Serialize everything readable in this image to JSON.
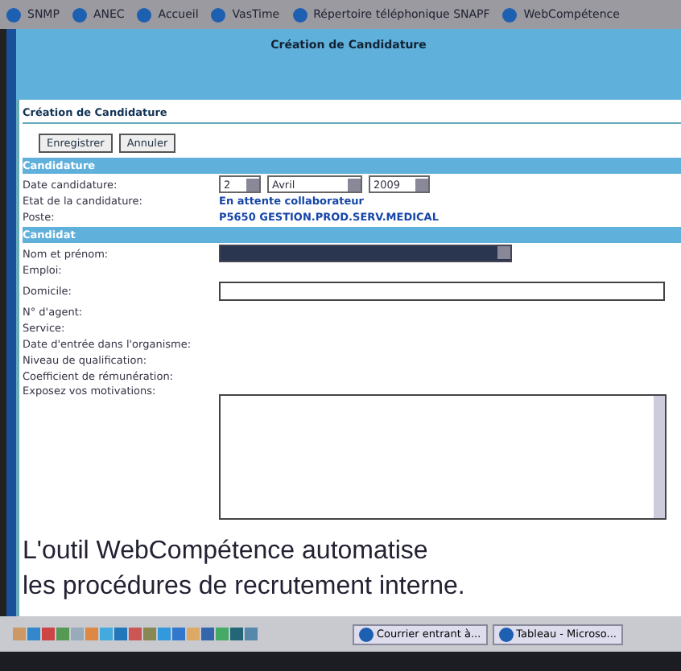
{
  "bookmarks": [
    "SNMP",
    "ANEC",
    "Accueil",
    "VasTime",
    "Répertoire téléphonique SNAPF",
    "WebCompétence"
  ],
  "page_title": "Création de Candidature",
  "form_title": "Création de Candidature",
  "buttons": [
    "Enregistrer",
    "Annuler"
  ],
  "sections": [
    {
      "title": "Candidature",
      "rows": [
        {
          "kind": "date",
          "label": "Date candidature:",
          "day": "2",
          "month": "Avril",
          "year": "2009"
        },
        {
          "kind": "value",
          "label": "Etat de la candidature:",
          "value": "En attente collaborateur"
        },
        {
          "kind": "value",
          "label": "Poste:",
          "value": "P5650 GESTION.PROD.SERV.MEDICAL"
        }
      ]
    },
    {
      "title": "Candidat",
      "rows": [
        {
          "kind": "select",
          "label": "Nom et prénom:"
        },
        {
          "kind": "plain",
          "label": "Emploi:"
        },
        {
          "kind": "input",
          "label": "Domicile:"
        },
        {
          "kind": "plain",
          "label": "N° d'agent:"
        },
        {
          "kind": "plain",
          "label": "Service:"
        },
        {
          "kind": "plain",
          "label": "Date d'entrée dans l'organisme:"
        },
        {
          "kind": "plain",
          "label": "Niveau de qualification:"
        },
        {
          "kind": "plain",
          "label": "Coefficient de rémunération:"
        },
        {
          "kind": "textarea",
          "label": "Exposez vos motivations:"
        }
      ]
    }
  ],
  "caption": [
    "L'outil WebCompétence automatise",
    "les procédures de recrutement interne."
  ],
  "taskbar": {
    "windows": [
      "Courrier entrant à...",
      "Tableau - Microso..."
    ]
  }
}
